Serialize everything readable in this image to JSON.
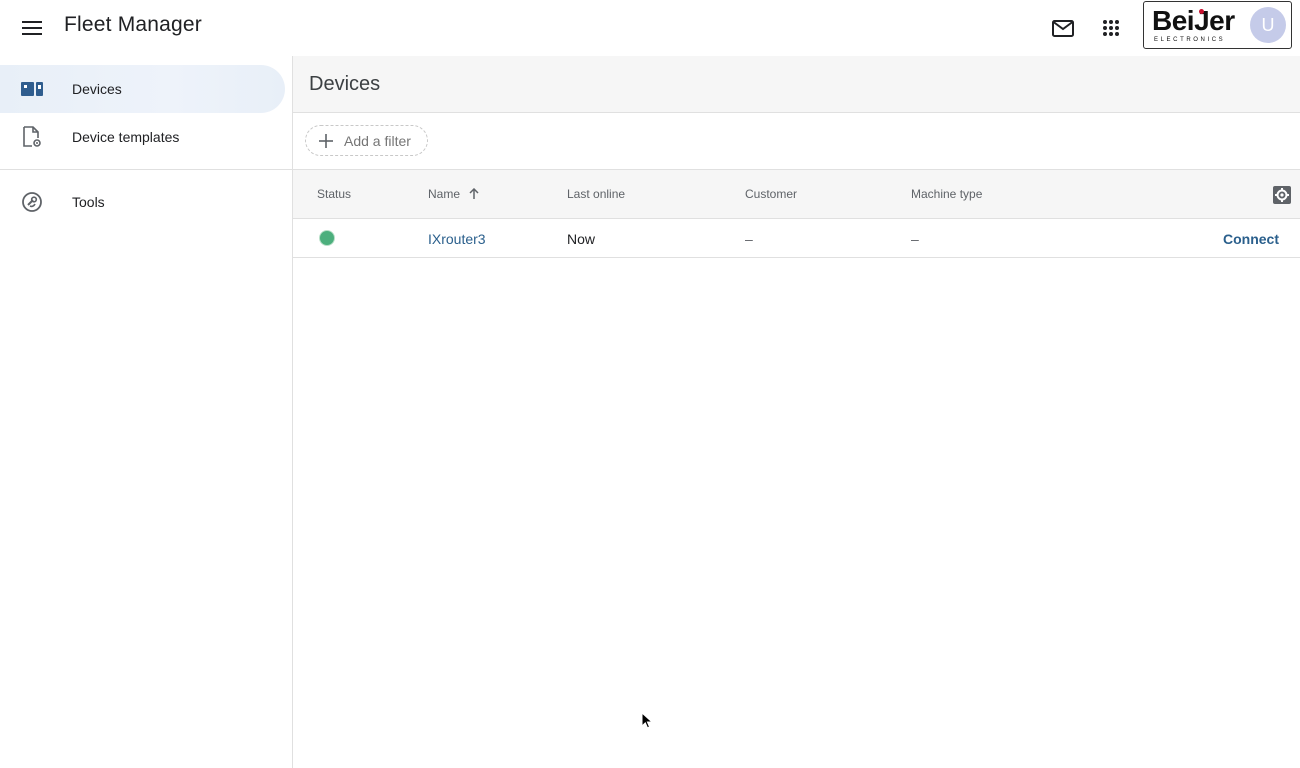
{
  "header": {
    "app_title": "Fleet Manager",
    "menu_icon": "hamburger-menu-icon",
    "mail_icon": "mail-icon",
    "apps_icon": "apps-grid-icon",
    "brand": {
      "logo_text": "BeiJer",
      "logo_subtext": "ELECTRONICS",
      "avatar_initial": "U",
      "accent": "#c8102e"
    }
  },
  "sidebar": {
    "items": [
      {
        "label": "Devices",
        "icon": "devices-icon",
        "active": true
      },
      {
        "label": "Device templates",
        "icon": "device-template-icon",
        "active": false
      },
      {
        "label": "Tools",
        "icon": "tools-icon",
        "active": false
      }
    ]
  },
  "main": {
    "title": "Devices",
    "filter": {
      "label": "Add a filter",
      "icon": "plus-icon"
    },
    "table": {
      "columns": [
        "Status",
        "Name",
        "Last online",
        "Customer",
        "Machine type"
      ],
      "sort_column": "Name",
      "sort_direction": "ascending",
      "rows": [
        {
          "status": "online",
          "status_color": "#4caf7d",
          "name": "IXrouter3",
          "last_online": "Now",
          "customer": "–",
          "machine_type": "–",
          "action": "Connect"
        }
      ]
    }
  }
}
